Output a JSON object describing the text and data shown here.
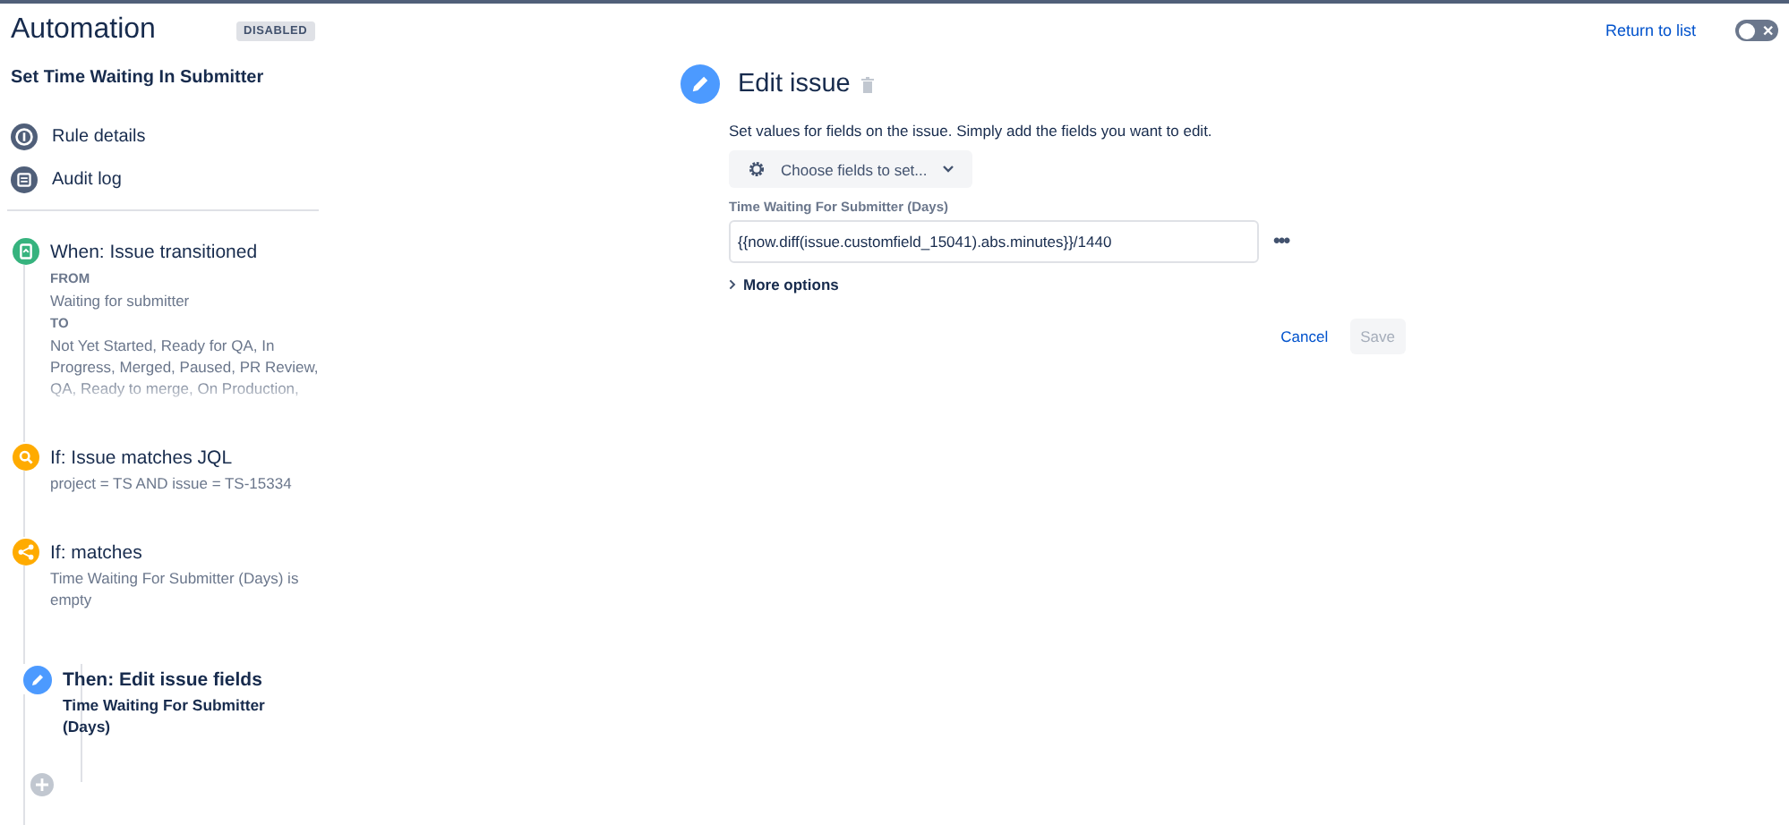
{
  "header": {
    "title": "Automation",
    "status_badge": "DISABLED",
    "return_link": "Return to list",
    "toggle": {
      "on": false,
      "symbol": "✕"
    }
  },
  "sidebar": {
    "rule_name": "Set Time Waiting In Submitter",
    "nav": [
      {
        "kind": "info",
        "label": "Rule details"
      },
      {
        "kind": "log",
        "label": "Audit log"
      }
    ],
    "steps": [
      {
        "kind": "trigger",
        "title": "When: Issue transitioned",
        "selected": false,
        "lines": [
          {
            "kind": "label",
            "text": "FROM"
          },
          {
            "kind": "text",
            "text": "Waiting for submitter"
          },
          {
            "kind": "label",
            "text": "TO"
          },
          {
            "kind": "text",
            "text": "Not Yet Started, Ready for QA, In Progress, Merged, Paused, PR Review, QA, Ready to merge, On Production,"
          }
        ]
      },
      {
        "kind": "jql",
        "title": "If: Issue matches JQL",
        "selected": false,
        "lines": [
          {
            "kind": "text",
            "text": "project = TS AND issue = TS-15334"
          }
        ]
      },
      {
        "kind": "branch",
        "title": "If: matches",
        "selected": false,
        "lines": [
          {
            "kind": "text",
            "text": "Time Waiting For Submitter (Days) is empty"
          }
        ],
        "children": [
          {
            "kind": "edit",
            "title": "Then: Edit issue fields",
            "selected": true,
            "lines": [
              {
                "kind": "text",
                "text": "Time Waiting For Submitter (Days)"
              }
            ]
          }
        ]
      }
    ]
  },
  "editor": {
    "title": "Edit issue",
    "description": "Set values for fields on the issue. Simply add the fields you want to edit.",
    "choose_button": "Choose fields to set...",
    "field": {
      "label": "Time Waiting For Submitter (Days)",
      "value": "{{now.diff(issue.customfield_15041).abs.minutes}}/1440",
      "more_actions": "•••"
    },
    "more_options": {
      "label": "More options",
      "expanded": false
    },
    "buttons": [
      {
        "kind": "link",
        "label": "Cancel",
        "disabled": false
      },
      {
        "kind": "primary",
        "label": "Save",
        "disabled": true
      }
    ]
  }
}
